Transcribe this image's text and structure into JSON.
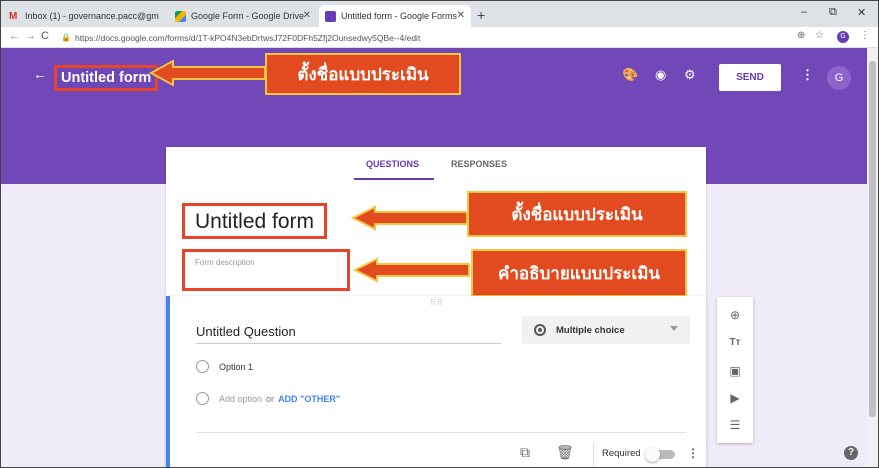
{
  "browser": {
    "tabs": [
      {
        "label": "Inbox (1) - governance.pacc@gm",
        "favicon_color": "#d93025"
      },
      {
        "label": "Google Form - Google Drive",
        "favicon_color": "#f4b400"
      },
      {
        "label": "Untitled form - Google Forms",
        "favicon_color": "#673ab7"
      }
    ],
    "url": "https://docs.google.com/forms/d/1T-kPO4N3ebDrtwsJ72F0DFh5Zfj2Ounsedwy5QBe--4/edit",
    "profile_initial": "G"
  },
  "appbar": {
    "title": "Untitled form",
    "send_label": "SEND",
    "avatar_initial": "G",
    "color": "#7248b9"
  },
  "callouts": {
    "name_form": "ตั้งชื่อแบบประเมิน",
    "name_form_2": "ตั้งชื่อแบบประเมิน",
    "describe_form": "คำอธิบายแบบประเมิน"
  },
  "form": {
    "tabs": {
      "questions": "QUESTIONS",
      "responses": "RESPONSES"
    },
    "title": "Untitled form",
    "description_placeholder": "Form description"
  },
  "question": {
    "title": "Untitled Question",
    "type": "Multiple choice",
    "options": [
      "Option 1"
    ],
    "add_option": "Add option",
    "or": "or",
    "add_other": "ADD \"OTHER\"",
    "required_label": "Required",
    "required": false
  },
  "icons": {
    "palette": "palette-icon",
    "preview": "eye-icon",
    "settings": "gear-icon",
    "add_question": "add-circle-icon",
    "add_title": "title-text-icon",
    "add_image": "image-icon",
    "add_video": "video-icon",
    "add_section": "section-icon"
  }
}
